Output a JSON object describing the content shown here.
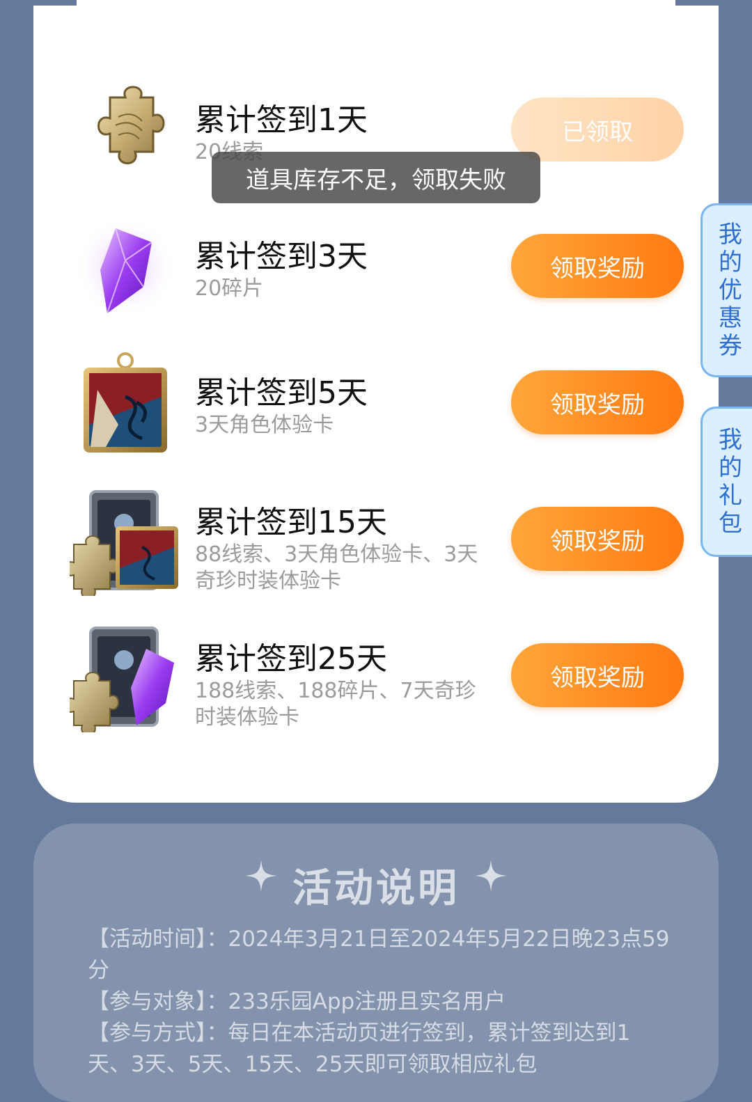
{
  "rewards": [
    {
      "title": "累计签到1天",
      "desc": "20线索",
      "button": "已领取",
      "claimed": true,
      "icon": "puzzle-piece-icon"
    },
    {
      "title": "累计签到3天",
      "desc": "20碎片",
      "button": "领取奖励",
      "claimed": false,
      "icon": "purple-crystal-icon"
    },
    {
      "title": "累计签到5天",
      "desc": "3天角色体验卡",
      "button": "领取奖励",
      "claimed": false,
      "icon": "character-card-icon"
    },
    {
      "title": "累计签到15天",
      "desc": "88线索、3天角色体验卡、3天奇珍时装体验卡",
      "button": "领取奖励",
      "claimed": false,
      "icon": "bundle-puzzle-card-icon"
    },
    {
      "title": "累计签到25天",
      "desc": "188线索、188碎片、7天奇珍时装体验卡",
      "button": "领取奖励",
      "claimed": false,
      "icon": "bundle-puzzle-crystal-icon"
    }
  ],
  "toast": "道具库存不足，领取失败",
  "side_tabs": {
    "coupons": "我的优惠券",
    "gifts": "我的礼包"
  },
  "info": {
    "title": "活动说明",
    "time_label": "【活动时间】：",
    "time_value": "2024年3月21日至2024年5月22日晚23点59分",
    "target_label": "【参与对象】：",
    "target_value": "233乐园App注册且实名用户",
    "method_label": "【参与方式】：",
    "method_value": "每日在本活动页进行签到，累计签到达到1天、3天、5天、15天、25天即可领取相应礼包"
  },
  "colors": {
    "background": "#64799b",
    "button_orange": "#ff8a1f",
    "button_claimed": "#ffdab5",
    "side_tab_text": "#2f6fcf"
  }
}
